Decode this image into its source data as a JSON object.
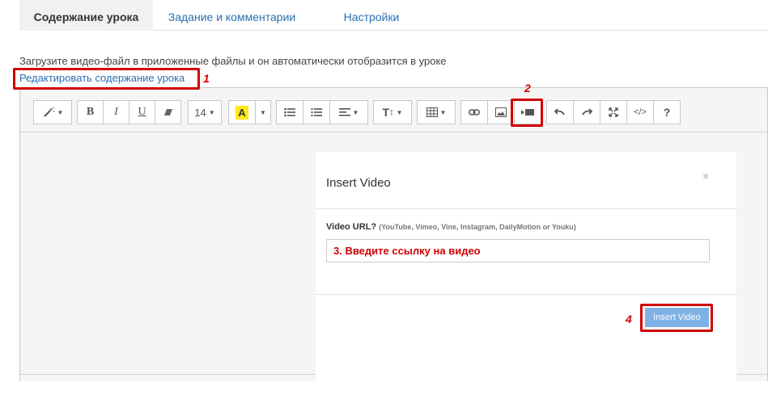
{
  "tabs": [
    {
      "label": "Содержание урока"
    },
    {
      "label": "Задание и комментарии"
    },
    {
      "label": "Настройки"
    }
  ],
  "description": "Загрузите видео-файл в приложенные файлы и он автоматически отобразится в уроке",
  "edit_link": "Редактировать содержание урока",
  "steps": {
    "s1": "1",
    "s2": "2",
    "s4": "4"
  },
  "toolbar": {
    "font_size": "14",
    "highlight_letter": "A",
    "text_style_label": "T",
    "help_label": "?",
    "code_label": "</>"
  },
  "modal": {
    "title": "Insert Video",
    "close": "×",
    "field_label": "Video URL?",
    "field_hint": "(YouTube, Vimeo, Vine, Instagram, DailyMotion or Youku)",
    "url_value": "3. Введите ссылку на видео",
    "insert_button": "Insert Video"
  },
  "colors": {
    "accent": "#2a6fb1",
    "annotation": "#d00000",
    "insert_button": "#7fb1e4",
    "highlight": "#ffe81a"
  }
}
